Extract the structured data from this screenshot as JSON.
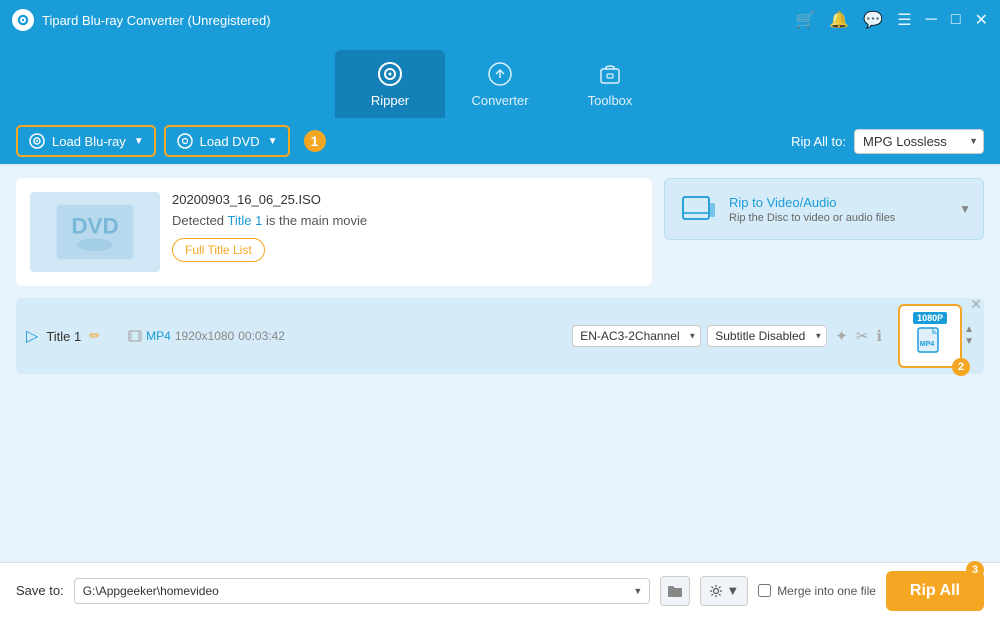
{
  "titleBar": {
    "title": "Tipard Blu-ray Converter (Unregistered)"
  },
  "nav": {
    "tabs": [
      {
        "id": "ripper",
        "label": "Ripper",
        "active": true
      },
      {
        "id": "converter",
        "label": "Converter",
        "active": false
      },
      {
        "id": "toolbox",
        "label": "Toolbox",
        "active": false
      }
    ]
  },
  "toolbar": {
    "loadBluray": "Load Blu-ray",
    "loadDvd": "Load DVD",
    "step1Label": "1",
    "ripAllToLabel": "Rip All to:",
    "ripFormat": "MPG Lossless"
  },
  "fileCard": {
    "fileName": "20200903_16_06_25.ISO",
    "detectedText": "Detected",
    "titleLink": "Title 1",
    "mainMovieText": "is the main movie",
    "fullTitleBtn": "Full Title List"
  },
  "ripToCard": {
    "title": "Rip to Video/Audio",
    "subtitle": "Rip the Disc to video or audio files"
  },
  "trackRow": {
    "titleLabel": "Title 1",
    "format": "MP4",
    "resolution": "1920x1080",
    "duration": "00:03:42",
    "audioTrack": "EN-AC3-2Channel",
    "subtitle": "Subtitle Disabled",
    "outputLabel": "1080P",
    "outputFormat": "MP4",
    "stepBadge": "2"
  },
  "bottomBar": {
    "saveToLabel": "Save to:",
    "savePath": "G:\\Appgeeker\\homevideo",
    "mergeLabel": "Merge into one file",
    "ripAllBtn": "Rip All",
    "stepBadge": "3"
  }
}
